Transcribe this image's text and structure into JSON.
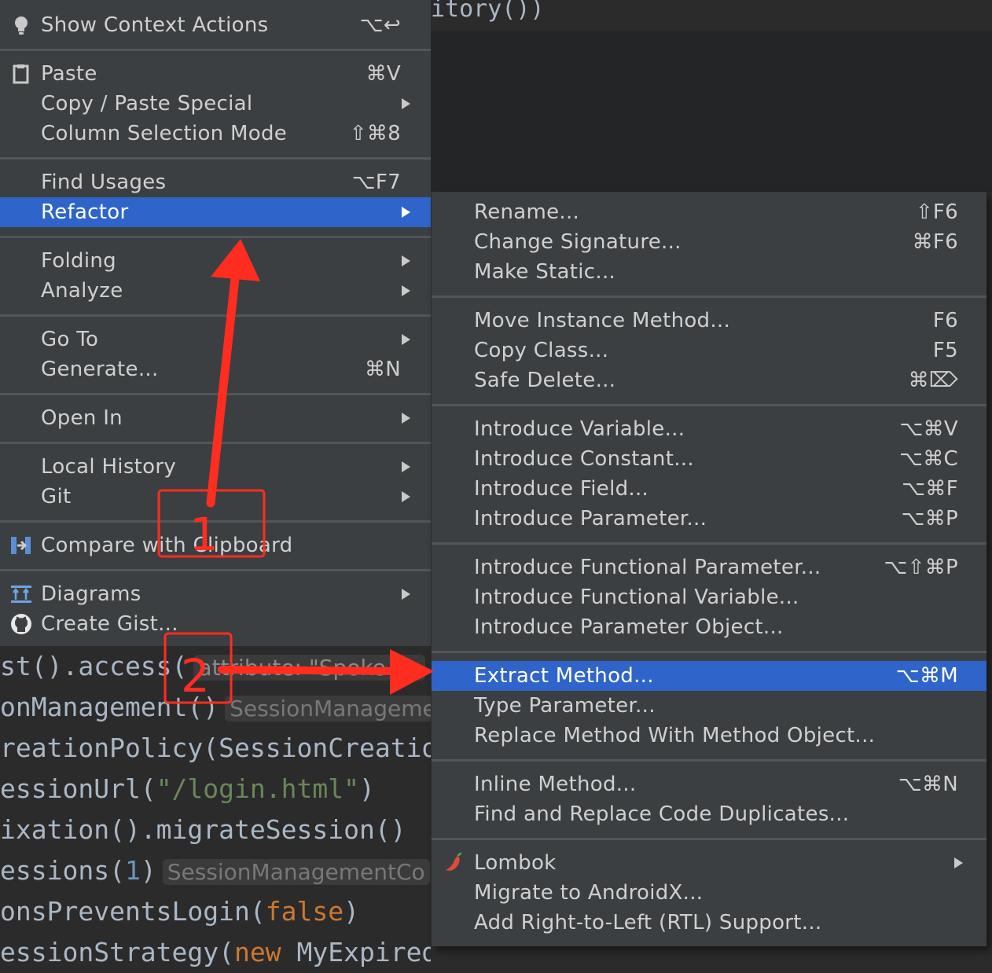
{
  "editor": {
    "top_code": "itory())",
    "lines": [
      {
        "parts": [
          {
            "t": "st().access(",
            "c": ""
          },
          {
            "t": "attribute: \"Spoke Se",
            "c": "hint-str"
          }
        ]
      },
      {
        "parts": [
          {
            "t": "onManagement()",
            "c": ""
          },
          {
            "t": "SessionManageme",
            "c": "hint"
          }
        ]
      },
      {
        "parts": [
          {
            "t": "reationPolicy(SessionCreation",
            "c": ""
          }
        ]
      },
      {
        "parts": [
          {
            "t": "essionUrl(",
            "c": ""
          },
          {
            "t": "\"/login.html\"",
            "c": "str"
          },
          {
            "t": ")",
            "c": ""
          }
        ]
      },
      {
        "parts": [
          {
            "t": "ixation().migrateSession()",
            "c": ""
          }
        ]
      },
      {
        "parts": [
          {
            "t": "essions(",
            "c": ""
          },
          {
            "t": "1",
            "c": "num"
          },
          {
            "t": ")",
            "c": ""
          },
          {
            "t": "SessionManagementCo",
            "c": "hint"
          }
        ]
      },
      {
        "parts": [
          {
            "t": "onsPreventsLogin(",
            "c": ""
          },
          {
            "t": "false",
            "c": "kw"
          },
          {
            "t": ")",
            "c": ""
          }
        ]
      },
      {
        "parts": [
          {
            "t": "essionStrategy(",
            "c": ""
          },
          {
            "t": "new",
            "c": "kw"
          },
          {
            "t": " MyExpiredSessionStrategy());",
            "c": ""
          }
        ]
      }
    ]
  },
  "main_menu": {
    "items": [
      {
        "label": "Show Context Actions",
        "shortcut": "⌥↩",
        "icon": "lightbulb-icon",
        "arrow": false
      },
      {
        "label": "Paste",
        "shortcut": "⌘V",
        "icon": "clipboard-icon",
        "arrow": false
      },
      {
        "label": "Copy / Paste Special",
        "shortcut": "",
        "arrow": true
      },
      {
        "label": "Column Selection Mode",
        "shortcut": "⇧⌘8",
        "arrow": false
      },
      {
        "label": "Find Usages",
        "shortcut": "⌥F7",
        "arrow": false
      },
      {
        "label": "Refactor",
        "shortcut": "",
        "arrow": true,
        "selected": true
      },
      {
        "label": "Folding",
        "shortcut": "",
        "arrow": true
      },
      {
        "label": "Analyze",
        "shortcut": "",
        "arrow": true
      },
      {
        "label": "Go To",
        "shortcut": "",
        "arrow": true
      },
      {
        "label": "Generate...",
        "shortcut": "⌘N",
        "arrow": false
      },
      {
        "label": "Open In",
        "shortcut": "",
        "arrow": true
      },
      {
        "label": "Local History",
        "shortcut": "",
        "arrow": true
      },
      {
        "label": "Git",
        "shortcut": "",
        "arrow": true
      },
      {
        "label": "Compare with Clipboard",
        "shortcut": "",
        "icon": "compare-icon",
        "arrow": false
      },
      {
        "label": "Diagrams",
        "shortcut": "",
        "icon": "diagram-icon",
        "arrow": true
      },
      {
        "label": "Create Gist...",
        "shortcut": "",
        "icon": "github-icon",
        "arrow": false
      }
    ]
  },
  "refactor_menu": {
    "items": [
      {
        "label": "Rename...",
        "shortcut": "⇧F6"
      },
      {
        "label": "Change Signature...",
        "shortcut": "⌘F6"
      },
      {
        "label": "Make Static...",
        "shortcut": ""
      },
      {
        "label": "Move Instance Method...",
        "shortcut": "F6"
      },
      {
        "label": "Copy Class...",
        "shortcut": "F5"
      },
      {
        "label": "Safe Delete...",
        "shortcut": "⌘⌦"
      },
      {
        "label": "Introduce Variable...",
        "shortcut": "⌥⌘V"
      },
      {
        "label": "Introduce Constant...",
        "shortcut": "⌥⌘C"
      },
      {
        "label": "Introduce Field...",
        "shortcut": "⌥⌘F"
      },
      {
        "label": "Introduce Parameter...",
        "shortcut": "⌥⌘P"
      },
      {
        "label": "Introduce Functional Parameter...",
        "shortcut": "⌥⇧⌘P"
      },
      {
        "label": "Introduce Functional Variable...",
        "shortcut": ""
      },
      {
        "label": "Introduce Parameter Object...",
        "shortcut": ""
      },
      {
        "label": "Extract Method...",
        "shortcut": "⌥⌘M",
        "selected": true
      },
      {
        "label": "Type Parameter...",
        "shortcut": ""
      },
      {
        "label": "Replace Method With Method Object...",
        "shortcut": ""
      },
      {
        "label": "Inline Method...",
        "shortcut": "⌥⌘N"
      },
      {
        "label": "Find and Replace Code Duplicates...",
        "shortcut": ""
      },
      {
        "label": "Lombok",
        "shortcut": "",
        "arrow": true,
        "icon": "chili-icon"
      },
      {
        "label": "Migrate to AndroidX...",
        "shortcut": ""
      },
      {
        "label": "Add Right-to-Left (RTL) Support...",
        "shortcut": ""
      }
    ]
  },
  "annotations": {
    "step1": "1",
    "step2": "2",
    "color": "#ff2d20"
  },
  "colors": {
    "menu_bg": "#3c3f41",
    "selection": "#2f65ca",
    "editor_bg": "#2b2b2b"
  }
}
